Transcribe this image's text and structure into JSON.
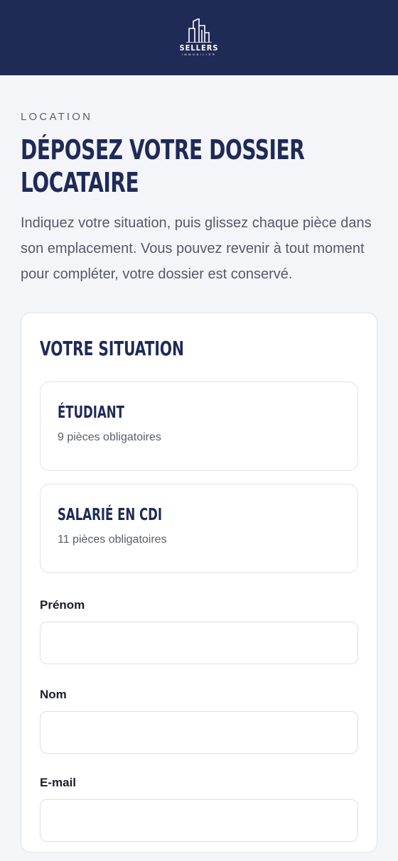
{
  "brand": {
    "name": "SELLERS",
    "tagline": "IMMOBILIER",
    "logo_icon": "building-logo-icon"
  },
  "page": {
    "eyebrow": "LOCATION",
    "title": "DÉPOSEZ VOTRE DOSSIER LOCATAIRE",
    "intro": "Indiquez votre situation, puis glissez chaque pièce dans son emplacement. Vous pouvez revenir à tout moment pour compléter, votre dossier est conservé."
  },
  "situation": {
    "title": "VOTRE SITUATION",
    "options": [
      {
        "label": "ÉTUDIANT",
        "detail": "9 pièces obligatoires"
      },
      {
        "label": "SALARIÉ EN CDI",
        "detail": "11 pièces obligatoires"
      }
    ]
  },
  "form": {
    "firstname": {
      "label": "Prénom",
      "value": "",
      "placeholder": ""
    },
    "lastname": {
      "label": "Nom",
      "value": "",
      "placeholder": ""
    },
    "email": {
      "label": "E-mail",
      "value": "",
      "placeholder": ""
    }
  },
  "colors": {
    "header_bg": "#1f2a57",
    "brand_navy": "#1f2a57",
    "page_bg": "#f4f5f9",
    "card_bg": "#ffffff"
  }
}
